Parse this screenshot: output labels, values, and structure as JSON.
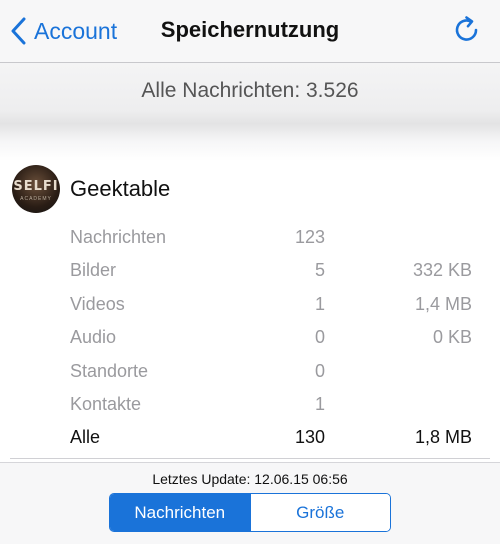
{
  "nav": {
    "back_label": "Account",
    "title": "Speichernutzung"
  },
  "summary": {
    "text": "Alle Nachrichten: 3.526"
  },
  "contact": {
    "name": "Geektable",
    "avatar_text": "SELFI",
    "avatar_subtext": "ACADEMY"
  },
  "stats": [
    {
      "label": "Nachrichten",
      "count": "123",
      "size": ""
    },
    {
      "label": "Bilder",
      "count": "5",
      "size": "332 KB"
    },
    {
      "label": "Videos",
      "count": "1",
      "size": "1,4 MB"
    },
    {
      "label": "Audio",
      "count": "0",
      "size": "0 KB"
    },
    {
      "label": "Standorte",
      "count": "0",
      "size": ""
    },
    {
      "label": "Kontakte",
      "count": "1",
      "size": ""
    },
    {
      "label": "Alle",
      "count": "130",
      "size": "1,8 MB"
    }
  ],
  "footer": {
    "last_update": "Letztes Update: 12.06.15 06:56",
    "segments": [
      "Nachrichten",
      "Größe"
    ],
    "selected_segment": "Nachrichten"
  },
  "colors": {
    "accent": "#1a73d9",
    "secondary_text": "#9a9a9e"
  },
  "icons": {
    "back": "chevron-left-icon",
    "refresh": "refresh-icon"
  }
}
